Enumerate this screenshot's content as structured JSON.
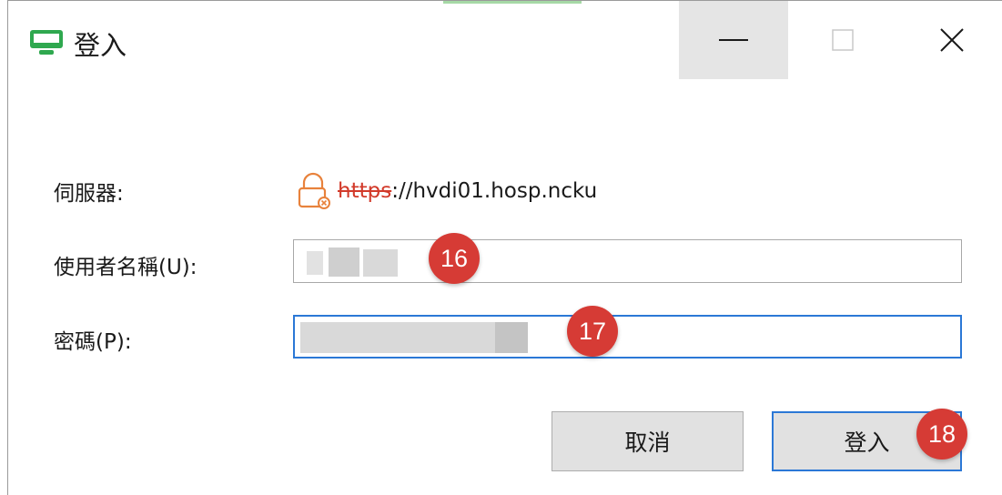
{
  "window": {
    "title": "登入",
    "icon": "monitor-icon",
    "accent_color": "#2fa84f",
    "controls": {
      "minimize": "minimize-icon",
      "maximize": "maximize-icon",
      "close": "close-icon"
    }
  },
  "form": {
    "server_label": "伺服器:",
    "server_lock_icon": "unlocked-warning-icon",
    "server_url_scheme": "https",
    "server_url_rest": "://hvdi01.hosp.ncku",
    "username_label": "使用者名稱(U):",
    "password_label": "密碼(P):"
  },
  "buttons": {
    "cancel": "取消",
    "login": "登入"
  },
  "markers": {
    "username": "16",
    "password": "17",
    "login": "18"
  },
  "colors": {
    "focus": "#2b78d6",
    "marker": "#d63b35",
    "url_warning": "#d23a2a"
  }
}
